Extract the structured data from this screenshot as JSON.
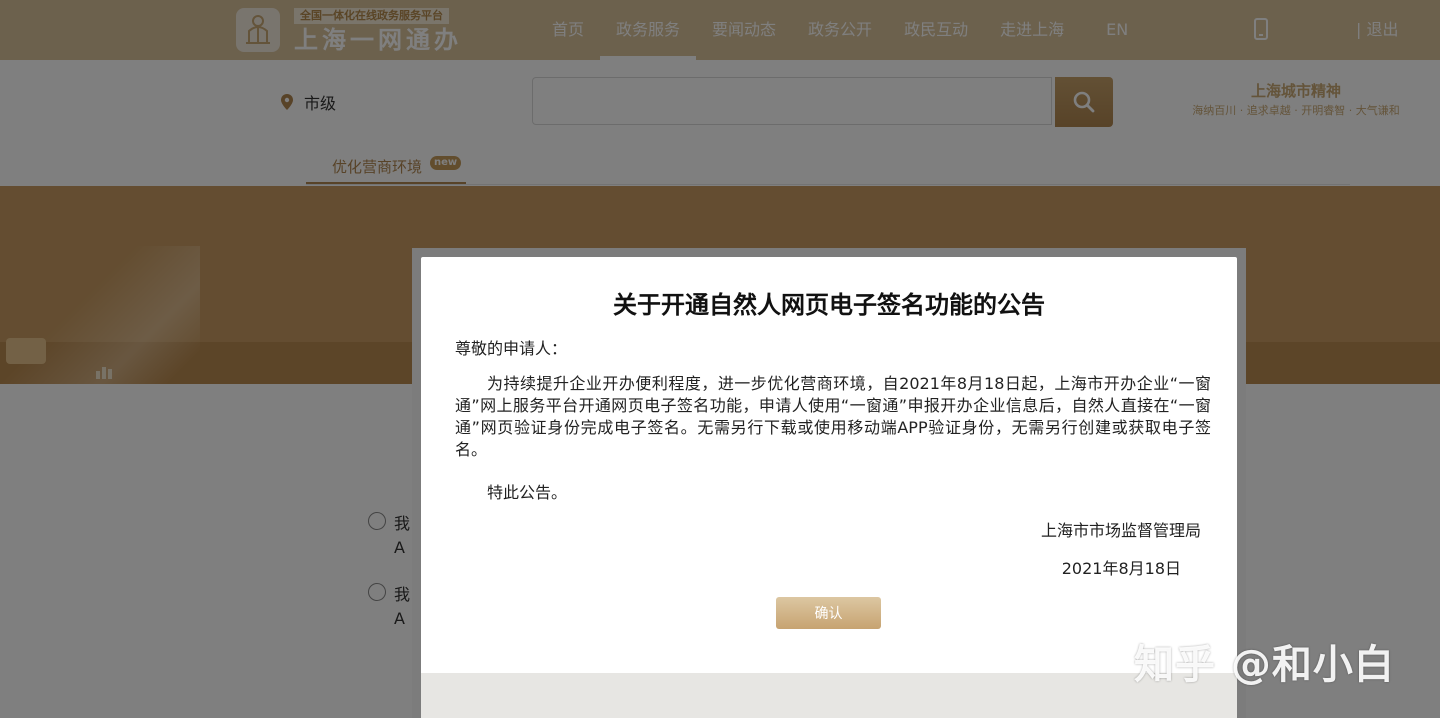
{
  "header": {
    "logo_sub": "全国一体化在线政务服务平台",
    "logo_main": "上海一网通办",
    "nav": [
      "首页",
      "政务服务",
      "要闻动态",
      "政务公开",
      "政民互动",
      "走进上海",
      "EN"
    ],
    "active_index": 1,
    "logout": "| 退出"
  },
  "search": {
    "location": "市级",
    "placeholder": ""
  },
  "slogan": {
    "title": "上海城市精神",
    "line": "海纳百川 · 追求卓越 · 开明睿智 · 大气谦和"
  },
  "subtab": {
    "label": "优化营商环境",
    "badge": "new"
  },
  "options": [
    {
      "line1": "我",
      "line2": "A"
    },
    {
      "line1": "我",
      "line2": "A"
    }
  ],
  "modal": {
    "title": "关于开通自然人网页电子签名功能的公告",
    "greeting": "尊敬的申请人：",
    "body": "为持续提升企业开办便利程度，进一步优化营商环境，自2021年8月18日起，上海市开办企业“一窗通”网上服务平台开通网页电子签名功能，申请人使用“一窗通”申报开办企业信息后，自然人直接在“一窗通”网页验证身份完成电子签名。无需另行下载或使用移动端APP验证身份，无需另行创建或获取电子签名。",
    "notice": "特此公告。",
    "org": "上海市市场监督管理局",
    "date": "2021年8月18日",
    "confirm": "确认"
  },
  "watermark": "知乎 @和小白",
  "colors": {
    "header_bg": "#d9c29a",
    "accent": "#b08650",
    "banner": "#c89b62"
  }
}
